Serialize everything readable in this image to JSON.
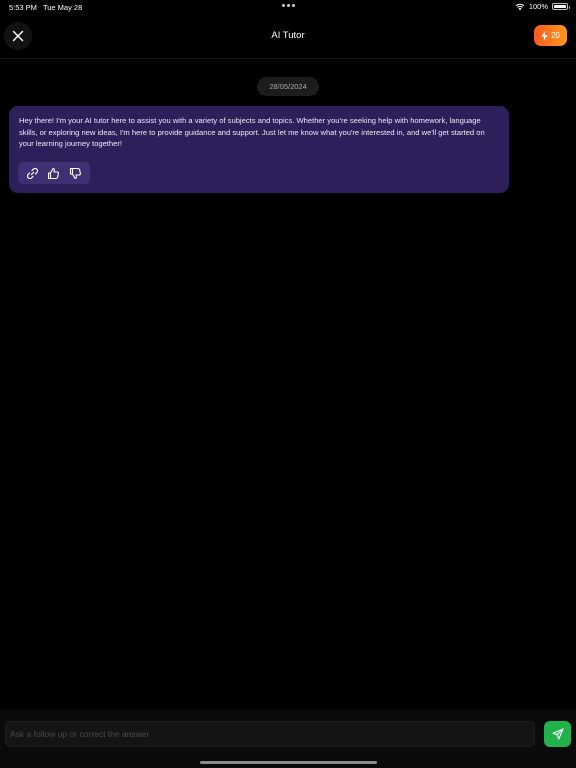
{
  "status_bar": {
    "time": "5:53 PM",
    "date": "Tue May 28",
    "battery_text": "100%",
    "battery_level": 1.0,
    "wifi_icon": "wifi-icon",
    "battery_icon": "battery-icon"
  },
  "header": {
    "title": "AI Tutor",
    "close_icon": "close-icon",
    "credits": "20",
    "credits_icon": "lightning-icon",
    "credits_gradient": [
      "#ff5a1f",
      "#ff9a1a"
    ]
  },
  "chat": {
    "date_label": "28/05/2024",
    "messages": [
      {
        "role": "assistant",
        "text": "Hey there! I'm your AI tutor here to assist you with a variety of subjects and topics. Whether you're seeking help with homework, language skills, or exploring new ideas, I'm here to provide guidance and support. Just let me know what you're interested in, and we'll get started on your learning journey together!",
        "bubble_color": "#2c1f5a",
        "actions": [
          "copy-icon",
          "thumbs-up-icon",
          "thumbs-down-icon"
        ]
      }
    ]
  },
  "composer": {
    "placeholder": "Ask a follow up or correct the answer",
    "value": "",
    "send_icon": "send-icon",
    "send_color": "#22b24c"
  }
}
